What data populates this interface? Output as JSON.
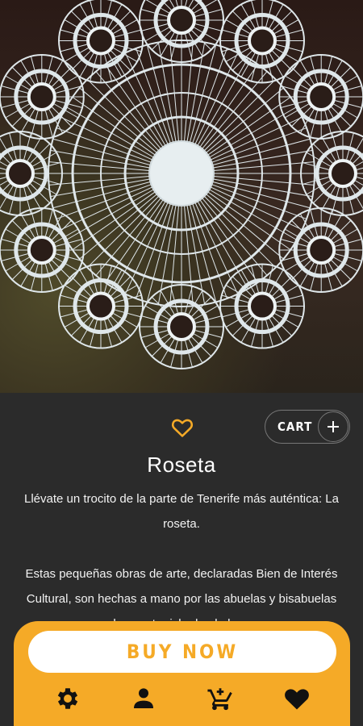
{
  "product": {
    "image_alt": "Roseta lace doily",
    "title": "Roseta",
    "description": [
      "Llévate un trocito de la parte de Tenerife más auténtica: La roseta.",
      "Estas pequeñas obras de arte, declaradas Bien de Interés Cultural, son hechas a mano por las abuelas y bisabuelas de nuestra isla desde hace"
    ]
  },
  "actions": {
    "favorite_icon": "heart-outline-icon",
    "cart_label": "CART",
    "cart_add_icon": "plus-icon",
    "buy_label": "BUY NOW"
  },
  "nav": {
    "items": [
      {
        "icon": "gear-icon"
      },
      {
        "icon": "person-icon"
      },
      {
        "icon": "cart-icon"
      },
      {
        "icon": "heart-icon"
      }
    ]
  },
  "colors": {
    "accent": "#f5aa27",
    "background": "#2b2b2b"
  }
}
